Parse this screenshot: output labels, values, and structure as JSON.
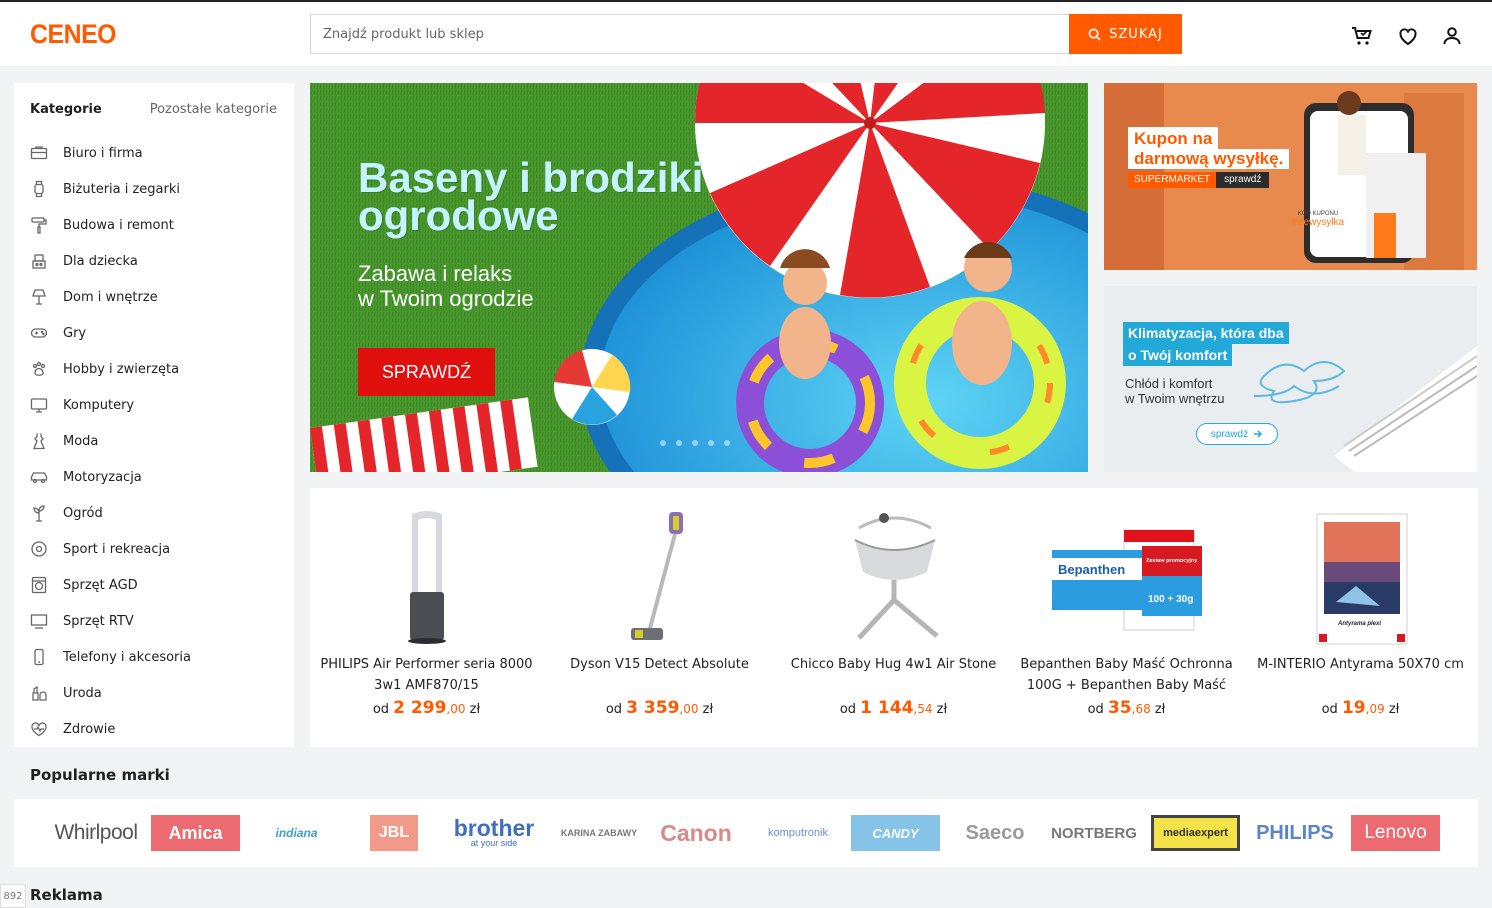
{
  "header": {
    "logo": "CENEO",
    "search_placeholder": "Znajdź produkt lub sklep",
    "search_button": "SZUKAJ",
    "colors": {
      "accent": "#ff5a00"
    }
  },
  "sidebar": {
    "title": "Kategorie",
    "other_link": "Pozostałe kategorie",
    "items": [
      {
        "label": "Biuro i firma",
        "icon": "briefcase-icon"
      },
      {
        "label": "Biżuteria i zegarki",
        "icon": "watch-icon"
      },
      {
        "label": "Budowa i remont",
        "icon": "paint-roller-icon"
      },
      {
        "label": "Dla dziecka",
        "icon": "toy-icon"
      },
      {
        "label": "Dom i wnętrze",
        "icon": "lamp-icon"
      },
      {
        "label": "Gry",
        "icon": "gamepad-icon"
      },
      {
        "label": "Hobby i zwierzęta",
        "icon": "paw-icon"
      },
      {
        "label": "Komputery",
        "icon": "monitor-icon"
      },
      {
        "label": "Moda",
        "icon": "dress-icon"
      },
      {
        "label": "Motoryzacja",
        "icon": "car-icon"
      },
      {
        "label": "Ogród",
        "icon": "plant-icon"
      },
      {
        "label": "Sport i rekreacja",
        "icon": "ball-icon"
      },
      {
        "label": "Sprzęt AGD",
        "icon": "washing-machine-icon"
      },
      {
        "label": "Sprzęt RTV",
        "icon": "tv-icon"
      },
      {
        "label": "Telefony i akcesoria",
        "icon": "phone-icon"
      },
      {
        "label": "Uroda",
        "icon": "cosmetics-icon"
      },
      {
        "label": "Zdrowie",
        "icon": "heart-pulse-icon"
      }
    ]
  },
  "hero": {
    "title_line1": "Baseny i brodziki",
    "title_line2": "ogrodowe",
    "subtitle_line1": "Zabawa i relaks",
    "subtitle_line2": "w Twoim ogrodzie",
    "button": "SPRAWDŹ"
  },
  "promo1": {
    "line1": "Kupon na",
    "line2": "darmową wysyłkę.",
    "tag": "SUPERMARKET",
    "tag_link": "sprawdź",
    "code_label": "KOD KUPONU",
    "code": "freewysylka"
  },
  "promo2": {
    "line1": "Klimatyzacja, która dba",
    "line2": "o Twój komfort",
    "sub1": "Chłód i komfort",
    "sub2": "w Twoim wnętrzu",
    "button": "sprawdź"
  },
  "products": [
    {
      "name": "PHILIPS Air Performer seria 8000 3w1 AMF870/15",
      "prefix": "od",
      "price_int": "2 299",
      "price_dec": ",00",
      "currency": "zł"
    },
    {
      "name": "Dyson V15 Detect Absolute",
      "prefix": "od",
      "price_int": "3 359",
      "price_dec": ",00",
      "currency": "zł"
    },
    {
      "name": "Chicco Baby Hug 4w1 Air Stone",
      "prefix": "od",
      "price_int": "1 144",
      "price_dec": ",54",
      "currency": "zł"
    },
    {
      "name": "Bepanthen Baby Maść Ochronna 100G + Bepanthen Baby Maść",
      "prefix": "od",
      "price_int": "35",
      "price_dec": ",68",
      "currency": "zł"
    },
    {
      "name": "M-INTERIO Antyrama 50X70 cm",
      "prefix": "od",
      "price_int": "19",
      "price_dec": ",09",
      "currency": "zł"
    }
  ],
  "product_images": {
    "bepanthen_brand": "Bepanthen",
    "bepanthen_box": "Zestaw promocyjny",
    "bepanthen_bonus": "100 + 30g",
    "antyrama_label": "Antyrama plexi"
  },
  "brands_title": "Popularne marki",
  "brands": [
    "Whirlpool",
    "Amica",
    "indiana",
    "JBL",
    "brother",
    "KARINA ZABAWY",
    "Canon",
    "komputronik",
    "CANDY",
    "Saeco",
    "NORTBERG",
    "mediaexpert",
    "PHILIPS",
    "Lenovo"
  ],
  "brands_extra": {
    "brother_tagline": "at your side"
  },
  "reklama": "Reklama",
  "page_number": "892"
}
